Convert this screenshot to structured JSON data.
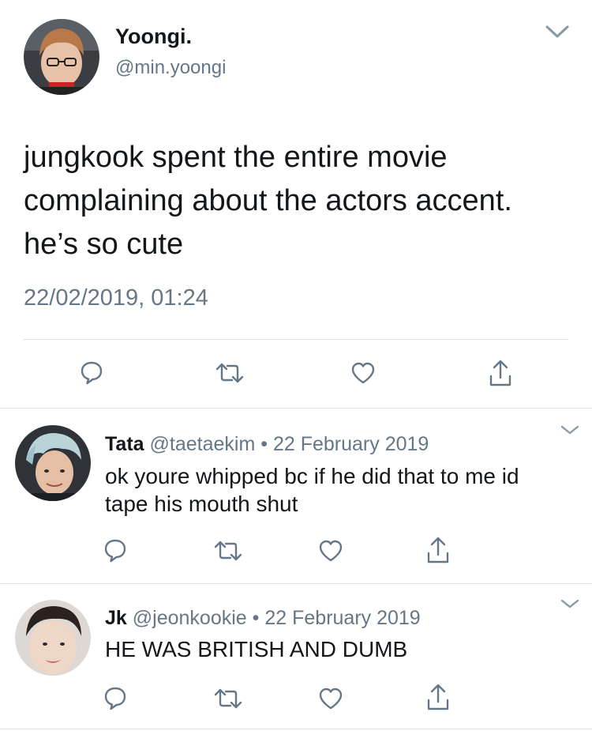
{
  "colors": {
    "text": "#14171a",
    "muted": "#657786",
    "divider": "#dfe3e7",
    "icon": "#657786"
  },
  "main_tweet": {
    "author_name": "Yoongi.",
    "handle": "@min.yoongi",
    "text_lines": [
      "jungkook spent the entire movie",
      "complaining about the actors accent.",
      "he’s so cute"
    ],
    "timestamp": "22/02/2019, 01:24",
    "icons": [
      "reply-icon",
      "retweet-icon",
      "like-icon",
      "share-icon",
      "chevron-down-icon"
    ]
  },
  "replies": [
    {
      "author_name": "Tata",
      "handle": "@taetaekim",
      "separator": "•",
      "date": "22 February 2019",
      "text_lines": [
        "ok youre whipped bc if he did that to me id",
        "tape his mouth shut"
      ]
    },
    {
      "author_name": "Jk",
      "handle": "@jeonkookie",
      "separator": "•",
      "date": "22 February 2019",
      "text_lines": [
        "HE WAS BRITISH AND DUMB"
      ]
    }
  ]
}
